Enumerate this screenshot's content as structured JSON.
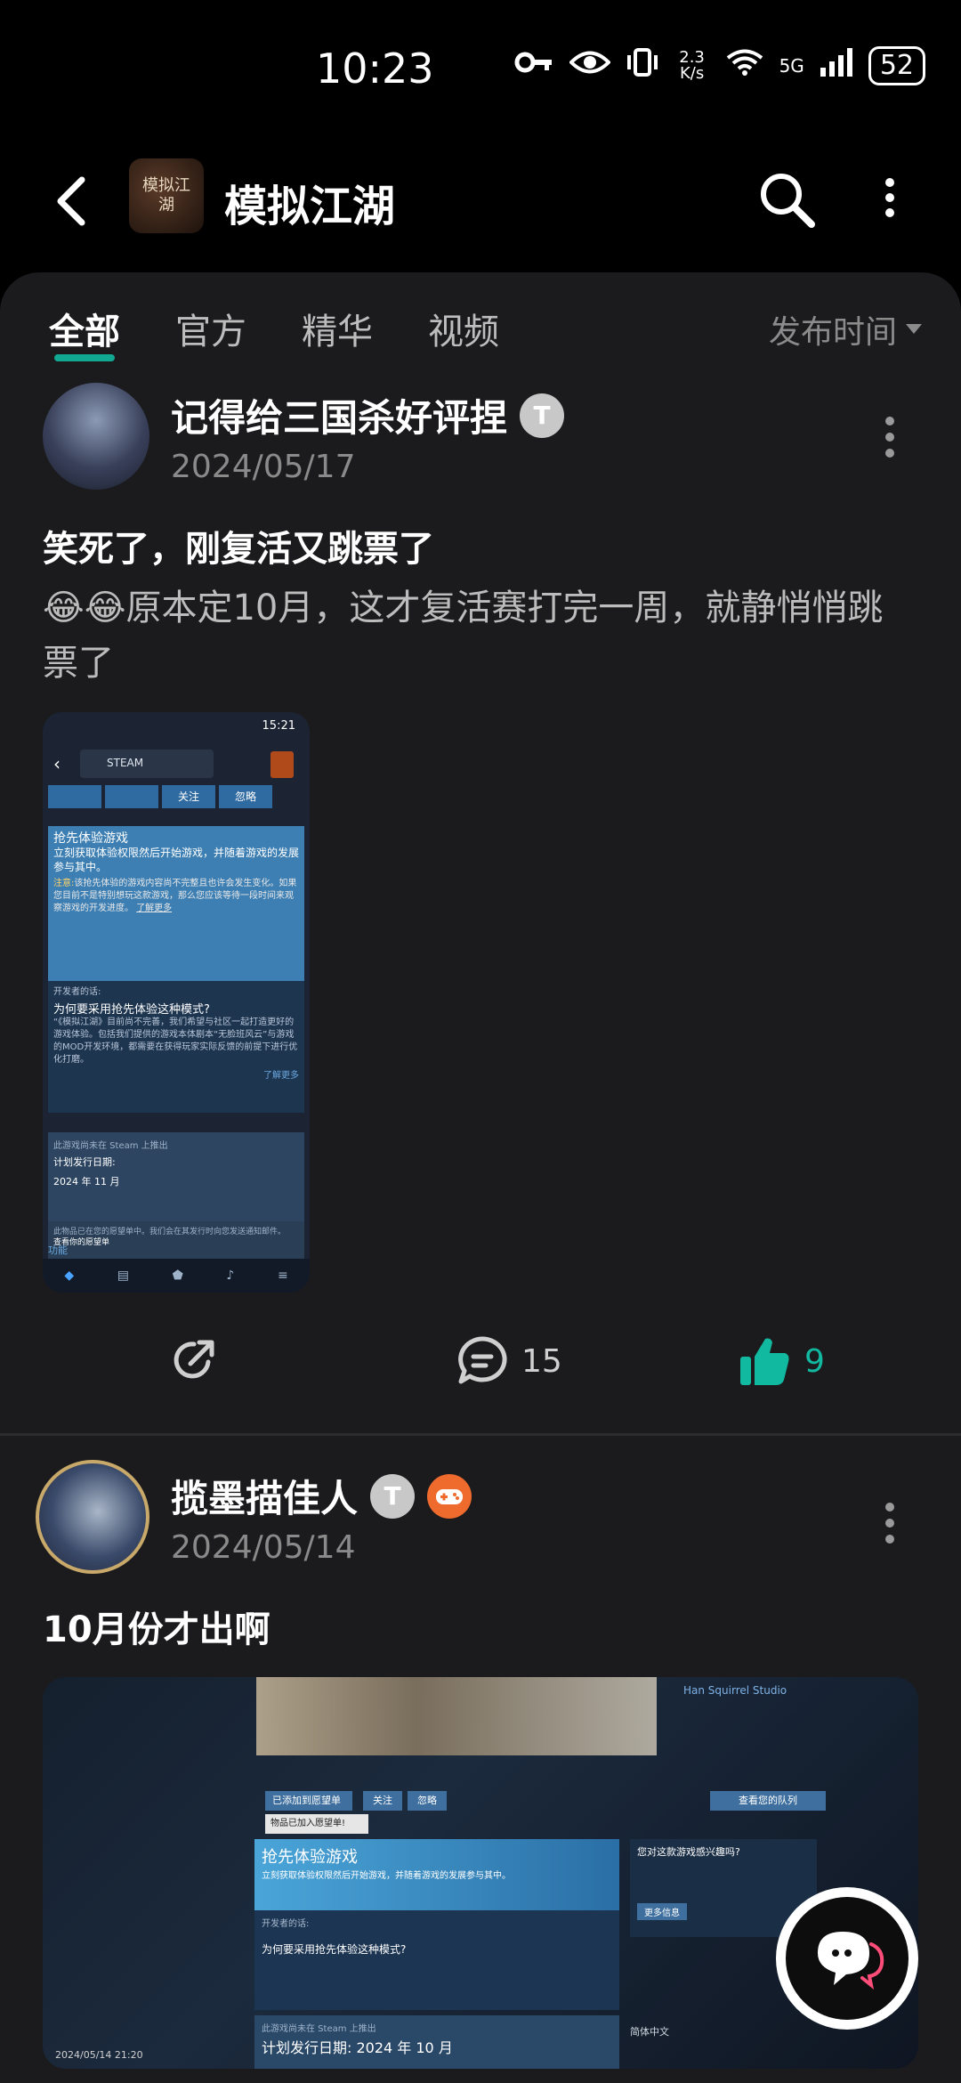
{
  "status_bar": {
    "time": "10:23",
    "net_speed": "2.3 K/s",
    "network": "5G",
    "battery": "52",
    "icons": [
      "key-icon",
      "eye-icon",
      "vibrate-icon",
      "wifi-icon",
      "signal-icon",
      "battery-icon"
    ]
  },
  "header": {
    "title": "模拟江湖",
    "app_icon_text": "模拟江湖"
  },
  "tabs": [
    "全部",
    "官方",
    "精华",
    "视频"
  ],
  "active_tab": 0,
  "sort": {
    "label": "发布时间"
  },
  "posts": [
    {
      "username": "记得给三国杀好评捏",
      "level": "T",
      "date": "2024/05/17",
      "title": "笑死了，刚复活又跳票了",
      "body": "😂😂原本定10月，这才复活赛打完一周，就静悄悄跳票了",
      "share_count": "",
      "comment_count": "15",
      "like_count": "9",
      "image": {
        "time": "15:21",
        "app": "STEAM",
        "buttons": [
          "关注",
          "忽略"
        ],
        "early_title": "抢先体验游戏",
        "early_desc": "立刻获取体验权限然后开始游戏，并随着游戏的发展参与其中。",
        "note_label": "注意:",
        "note": "该抢先体验的游戏内容尚不完整且也许会发生变化。如果您目前不是特别想玩这款游戏，那么您应该等待一段时间来观察游戏的开发进度。",
        "learn_more": "了解更多",
        "dev_says": "开发者的话:",
        "why_title": "为何要采用抢先体验这种模式?",
        "why_text": "“《模拟江湖》目前尚不完善，我们希望与社区一起打造更好的游戏体验。包括我们提供的游戏本体剧本“无脸班风云”与游戏的MOD开发环境，都需要在获得玩家实际反馈的前提下进行优化打磨。",
        "why_more": "了解更多",
        "not_released": "此游戏尚未在 Steam 上推出",
        "release_label": "计划发行日期:",
        "release_date": "2024 年 11 月",
        "wishlist_note": "此物品已在您的愿望单中。我们会在其发行时向您发送通知邮件。",
        "wishlist_link": "查看你的愿望单",
        "features": "功能"
      }
    },
    {
      "username": "揽墨描佳人",
      "level": "T",
      "date": "2024/05/14",
      "title": "10月份才出啊",
      "image": {
        "timestamp": "2024/05/14 21:20",
        "wishlist_btn": "已添加到愿望单",
        "follow": "关注",
        "ignore": "忽略",
        "queue": "查看您的队列",
        "added": "物品已加入愿望单!",
        "early_title": "抢先体验游戏",
        "early_desc": "立刻获取体验权限然后开始游戏，并随着游戏的发展参与其中。",
        "dev_says": "开发者的话:",
        "why_title": "为何要采用抢先体验这种模式?",
        "interest": "您对这款游戏感兴趣吗?",
        "more_info": "更多信息",
        "not_released": "此游戏尚未在 Steam 上推出",
        "release": "计划发行日期: 2024 年 10 月",
        "dev": "Han Squirrel Studio",
        "lang": "简体中文"
      }
    }
  ]
}
